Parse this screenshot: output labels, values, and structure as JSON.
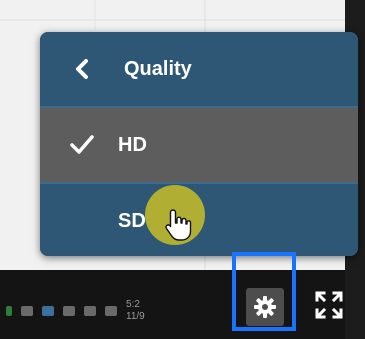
{
  "menu": {
    "back_icon": "chevron-left-icon",
    "title": "Quality",
    "options": [
      {
        "label": "HD",
        "selected": true
      },
      {
        "label": "SD",
        "selected": false
      }
    ]
  },
  "taskbar": {
    "time": "5:2",
    "date": "11/9"
  },
  "controls": {
    "settings_icon": "gear-icon",
    "fullscreen_icon": "fullscreen-icon"
  },
  "colors": {
    "menu_bg": "#2e5776",
    "selected_bg": "#5d5d5d",
    "highlight_border": "#1a73ff",
    "cursor_halo": "#c8be28"
  }
}
